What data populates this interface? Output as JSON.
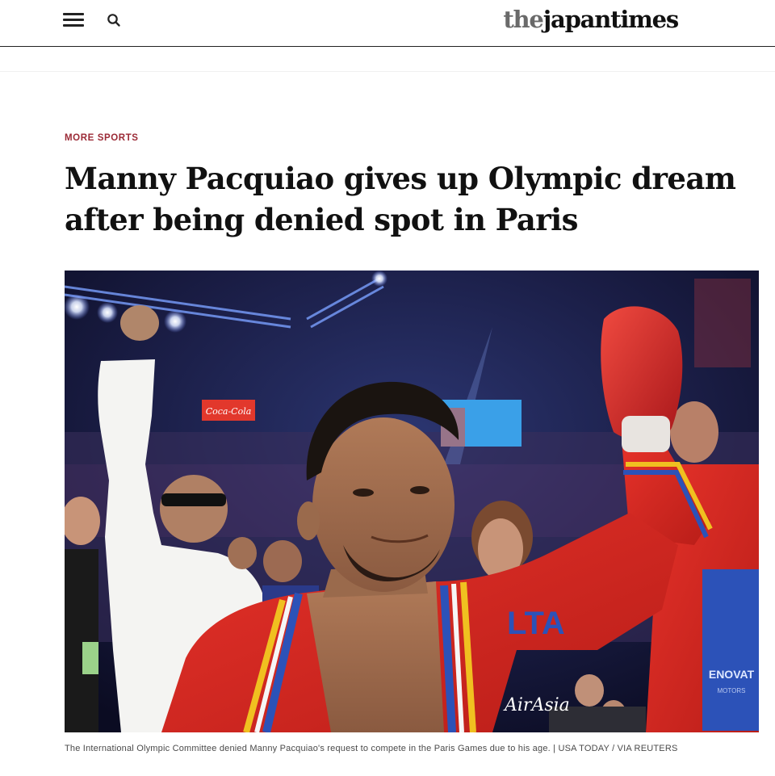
{
  "header": {
    "menu_icon": "hamburger-menu-icon",
    "search_icon": "search-icon",
    "logo_prefix": "the",
    "logo_main": "japan",
    "logo_suffix": "times"
  },
  "article": {
    "section": "MORE SPORTS",
    "title": "Manny Pacquiao gives up Olympic dream after being denied spot in Paris",
    "image_caption": "The International Olympic Committee denied Manny Pacquiao's request to compete in the Paris Games due to his age. | USA TODAY / VIA REUTERS",
    "image_signage": {
      "robe_text_left": "LTA",
      "robe_text_right": "AirAsia",
      "banner": "ENOVAT",
      "banner_sub": "MOTORS",
      "sign": "Coca-Cola"
    }
  },
  "colors": {
    "kicker": "#9b2a36",
    "rule": "#222222",
    "robe_red": "#d8261e"
  }
}
